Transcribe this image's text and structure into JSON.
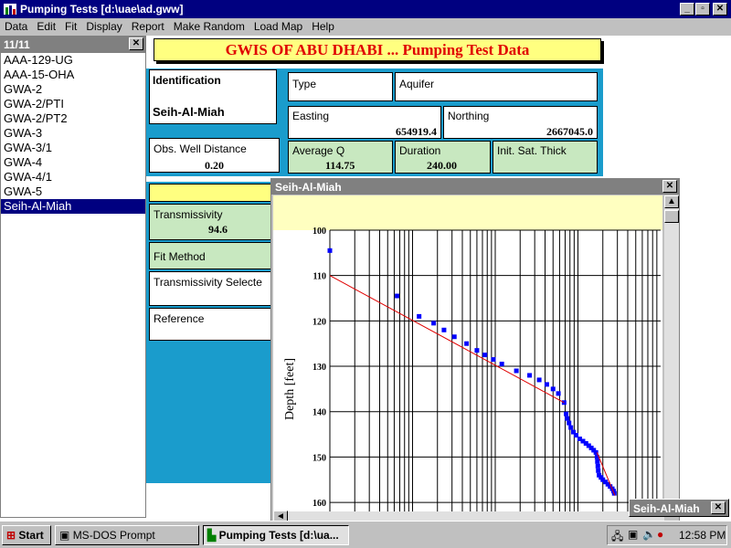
{
  "window": {
    "title": "Pumping Tests [d:\\uae\\ad.gww]"
  },
  "menu": [
    "Data",
    "Edit",
    "Fit",
    "Display",
    "Report",
    "Make Random",
    "Load Map",
    "Help"
  ],
  "list": {
    "count": "11/11",
    "items": [
      "AAA-129-UG",
      "AAA-15-OHA",
      "GWA-2",
      "GWA-2/PTI",
      "GWA-2/PT2",
      "GWA-3",
      "GWA-3/1",
      "GWA-4",
      "GWA-4/1",
      "GWA-5",
      "Seih-Al-Miah"
    ],
    "selected": "Seih-Al-Miah"
  },
  "form": {
    "banner": "GWIS OF ABU DHABI ... Pumping Test Data",
    "identification_label": "Identification",
    "identification_value": "Seih-Al-Miah",
    "type_label": "Type",
    "aquifer_label": "Aquifer",
    "easting_label": "Easting",
    "easting_value": "654919.4",
    "northing_label": "Northing",
    "northing_value": "2667045.0",
    "obs_label": "Obs. Well Distance",
    "obs_value": "0.20",
    "avgq_label": "Average Q",
    "avgq_value": "114.75",
    "duration_label": "Duration",
    "duration_value": "240.00",
    "initsat_label": "Init. Sat. Thick",
    "transmissivity_label": "Transmissivity",
    "transmissivity_value": "94.6",
    "fitmethod_label": "Fit Method",
    "tselected_label": "Transmissivity Selecte",
    "reference_label": "Reference"
  },
  "chart_window": {
    "title": "Seih-Al-Miah"
  },
  "minimized_window": {
    "title": "Seih-Al-Miah"
  },
  "taskbar": {
    "start": "Start",
    "tasks": [
      "MS-DOS Prompt",
      "Pumping Tests [d:\\ua..."
    ],
    "clock": "12:58 PM"
  },
  "chart_data": {
    "type": "scatter",
    "ylabel": "Depth [feet]",
    "xlabel": "",
    "y_reversed": true,
    "x_scale": "log",
    "xlim": [
      0.1,
      1000
    ],
    "ylim": [
      100,
      160
    ],
    "y_ticks": [
      100,
      110,
      120,
      130,
      140,
      150,
      160
    ],
    "series": [
      {
        "kind": "points",
        "color": "#0000ff",
        "points": [
          [
            0.1,
            104.5
          ],
          [
            0.65,
            114.5
          ],
          [
            1.2,
            119
          ],
          [
            1.8,
            120.5
          ],
          [
            2.4,
            122
          ],
          [
            3.2,
            123.5
          ],
          [
            4.5,
            125
          ],
          [
            6,
            126.5
          ],
          [
            7.5,
            127.5
          ],
          [
            9.5,
            128.5
          ],
          [
            12,
            129.5
          ],
          [
            18,
            131
          ],
          [
            26,
            132
          ],
          [
            34,
            133
          ],
          [
            42,
            134
          ],
          [
            50,
            135
          ],
          [
            58,
            136
          ],
          [
            68,
            138
          ],
          [
            72,
            140.5
          ],
          [
            74,
            141.5
          ],
          [
            78,
            142.5
          ],
          [
            82,
            143.5
          ],
          [
            88,
            144.5
          ],
          [
            95,
            145.2
          ],
          [
            105,
            146
          ],
          [
            115,
            146.5
          ],
          [
            125,
            147
          ],
          [
            135,
            147.5
          ],
          [
            145,
            148
          ],
          [
            155,
            148.5
          ],
          [
            165,
            149
          ],
          [
            170,
            150
          ],
          [
            172,
            151
          ],
          [
            174,
            152
          ],
          [
            176,
            153
          ],
          [
            180,
            154
          ],
          [
            190,
            154.5
          ],
          [
            200,
            155
          ],
          [
            215,
            155.5
          ],
          [
            230,
            156
          ],
          [
            245,
            156.5
          ],
          [
            260,
            157
          ],
          [
            270,
            157.5
          ],
          [
            275,
            158
          ]
        ]
      },
      {
        "kind": "line",
        "color": "#e00000",
        "points": [
          [
            0.1,
            110
          ],
          [
            68,
            138
          ]
        ]
      },
      {
        "kind": "line",
        "color": "#e00000",
        "points": [
          [
            170,
            149
          ],
          [
            280,
            158.5
          ]
        ]
      }
    ]
  }
}
